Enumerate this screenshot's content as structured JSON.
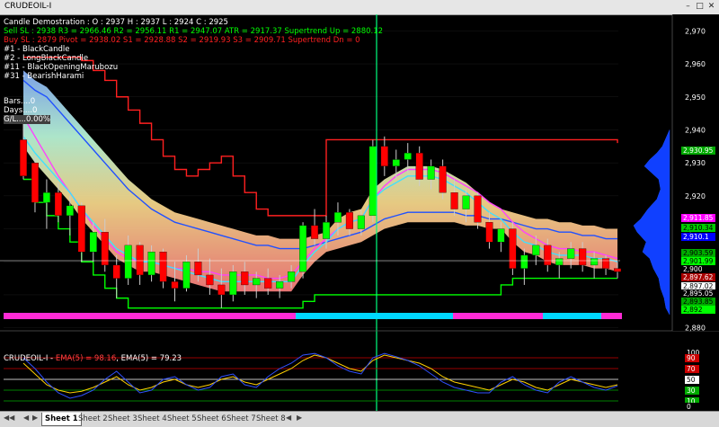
{
  "window": {
    "title": "CRUDEOIL-I",
    "controls": [
      "minimize",
      "maximize",
      "close"
    ]
  },
  "header": {
    "line1": "Candle Demostration : O : 2937 H : 2937 L : 2924 C : 2925",
    "line2": "Sell SL : 2938 R3 = 2966.46 R2 = 2956.11 R1 = 2947.07 ATR = 2917.37 Supertrend Up = 2880.12",
    "line3": "Buy SL : 2879 Pivot = 2938.02 S1 = 2928.88 S2 = 2919.93 S3 = 2909.71 Supertrend Dn = 0",
    "patterns": [
      "#1 - BlackCandle",
      "#2 - LongBlackCandle",
      "#11 - BlackOpeningMarubozu",
      "#31 - BearishHarami"
    ],
    "stats": [
      {
        "label": "Bars",
        "value": "0"
      },
      {
        "label": "Days",
        "value": "0"
      },
      {
        "label": "G/L",
        "value": "0.00%"
      }
    ]
  },
  "colors": {
    "up": "#00ff00",
    "down": "#ff0000",
    "bg": "#000000",
    "axis": "#ffffff",
    "sellText": "#00ff00",
    "buyText": "#ff0000"
  },
  "price_axis": {
    "ticks": [
      "2,970",
      "2,960",
      "2,950",
      "2,940",
      "2,930",
      "2,920",
      "2,910",
      "2,900",
      "2,890",
      "2,880"
    ],
    "labels": [
      {
        "value": "2,930.95",
        "bg": "#00aa00",
        "fg": "#ffffff"
      },
      {
        "value": "2,911.85",
        "bg": "#ff00ff",
        "fg": "#ffffff"
      },
      {
        "value": "2,910.34",
        "bg": "#00cc00",
        "fg": "#000000"
      },
      {
        "value": "2,910.1",
        "bg": "#0000ff",
        "fg": "#ffffff"
      },
      {
        "value": "2,903.59",
        "bg": "#00aa00",
        "fg": "#000000"
      },
      {
        "value": "2,901.99",
        "bg": "#00ff00",
        "fg": "#000000"
      },
      {
        "value": "2,900",
        "bg": "#000000",
        "fg": "#ffffff"
      },
      {
        "value": "2,897.62",
        "bg": "#aa0000",
        "fg": "#ffffff"
      },
      {
        "value": "2,897.02",
        "bg": "#ffffff",
        "fg": "#000000"
      },
      {
        "value": "2,895.05",
        "bg": "#000000",
        "fg": "#ffffff"
      },
      {
        "value": "2,893.85",
        "bg": "#00aa00",
        "fg": "#000000"
      },
      {
        "value": "2,892",
        "bg": "#00ff00",
        "fg": "#000000"
      }
    ]
  },
  "indicator": {
    "name": "CRUDEOIL-I",
    "ema1": "EMA(5) = 98.16",
    "ema2": "EMA(5) = 79.23",
    "levels": [
      {
        "value": "100",
        "bg": "#000000",
        "fg": "#ffffff"
      },
      {
        "value": "90",
        "bg": "#cc0000",
        "fg": "#ffffff"
      },
      {
        "value": "70",
        "bg": "#cc0000",
        "fg": "#ffffff"
      },
      {
        "value": "50",
        "bg": "#ffffff",
        "fg": "#000000"
      },
      {
        "value": "30",
        "bg": "#00aa00",
        "fg": "#ffffff"
      },
      {
        "value": "10",
        "bg": "#00aa00",
        "fg": "#ffffff"
      },
      {
        "value": "0",
        "bg": "#000000",
        "fg": "#ffffff"
      }
    ]
  },
  "sheets": {
    "active": "Sheet 1",
    "items": [
      "Sheet 1",
      "Sheet 2",
      "Sheet 3",
      "Sheet 4",
      "Sheet 5",
      "Sheet 6",
      "Sheet 7",
      "Sheet 8"
    ]
  },
  "chart_data": {
    "type": "candlestick",
    "ylim": [
      2878,
      2975
    ],
    "candles": [
      [
        2937,
        2944,
        2925,
        2926
      ],
      [
        2930,
        2932,
        2915,
        2918
      ],
      [
        2918,
        2925,
        2910,
        2921
      ],
      [
        2921,
        2924,
        2912,
        2914
      ],
      [
        2914,
        2920,
        2908,
        2917
      ],
      [
        2917,
        2918,
        2900,
        2903
      ],
      [
        2903,
        2912,
        2900,
        2909
      ],
      [
        2909,
        2913,
        2897,
        2899
      ],
      [
        2899,
        2902,
        2889,
        2895
      ],
      [
        2895,
        2908,
        2893,
        2905
      ],
      [
        2905,
        2906,
        2893,
        2896
      ],
      [
        2896,
        2905,
        2894,
        2903
      ],
      [
        2903,
        2904,
        2892,
        2894
      ],
      [
        2894,
        2900,
        2888,
        2892
      ],
      [
        2892,
        2902,
        2891,
        2900
      ],
      [
        2900,
        2904,
        2894,
        2896
      ],
      [
        2896,
        2901,
        2890,
        2893
      ],
      [
        2893,
        2898,
        2886,
        2890
      ],
      [
        2890,
        2899,
        2888,
        2897
      ],
      [
        2897,
        2900,
        2890,
        2893
      ],
      [
        2893,
        2897,
        2889,
        2895
      ],
      [
        2895,
        2898,
        2890,
        2892
      ],
      [
        2892,
        2896,
        2889,
        2894
      ],
      [
        2894,
        2899,
        2892,
        2897
      ],
      [
        2897,
        2912,
        2895,
        2911
      ],
      [
        2911,
        2916,
        2905,
        2907
      ],
      [
        2907,
        2914,
        2904,
        2912
      ],
      [
        2912,
        2918,
        2908,
        2915
      ],
      [
        2915,
        2916,
        2908,
        2910
      ],
      [
        2910,
        2916,
        2908,
        2914
      ],
      [
        2914,
        2937,
        2912,
        2935
      ],
      [
        2935,
        2938,
        2926,
        2929
      ],
      [
        2929,
        2934,
        2925,
        2931
      ],
      [
        2931,
        2936,
        2927,
        2933
      ],
      [
        2933,
        2935,
        2923,
        2925
      ],
      [
        2925,
        2931,
        2922,
        2929
      ],
      [
        2929,
        2931,
        2919,
        2921
      ],
      [
        2921,
        2925,
        2914,
        2916
      ],
      [
        2916,
        2922,
        2912,
        2920
      ],
      [
        2920,
        2921,
        2910,
        2912
      ],
      [
        2912,
        2915,
        2904,
        2906
      ],
      [
        2906,
        2912,
        2903,
        2910
      ],
      [
        2910,
        2912,
        2896,
        2898
      ],
      [
        2898,
        2904,
        2893,
        2902
      ],
      [
        2902,
        2908,
        2899,
        2905
      ],
      [
        2905,
        2907,
        2897,
        2899
      ],
      [
        2899,
        2903,
        2895,
        2901
      ],
      [
        2901,
        2906,
        2898,
        2904
      ],
      [
        2904,
        2906,
        2897,
        2899
      ],
      [
        2899,
        2903,
        2895,
        2901
      ],
      [
        2901,
        2902,
        2896,
        2898
      ],
      [
        2898,
        2900,
        2895,
        2897
      ]
    ],
    "overlays": [
      {
        "name": "resistance",
        "color": "#ff2020",
        "values": [
          2962,
          2962,
          2962,
          2962,
          2962,
          2961,
          2958,
          2955,
          2950,
          2946,
          2942,
          2937,
          2932,
          2928,
          2926,
          2928,
          2930,
          2932,
          2926,
          2921,
          2916,
          2914,
          2914,
          2914,
          2914,
          2914,
          2937,
          2937,
          2937,
          2937,
          2937,
          2937,
          2937,
          2937,
          2937,
          2937,
          2937,
          2937,
          2937,
          2937,
          2937,
          2937,
          2937,
          2937,
          2937,
          2937,
          2937,
          2937,
          2937,
          2937,
          2937,
          2936
        ]
      },
      {
        "name": "support",
        "color": "#00ff00",
        "values": [
          2925,
          2918,
          2914,
          2910,
          2906,
          2900,
          2896,
          2892,
          2889,
          2886,
          2886,
          2886,
          2886,
          2886,
          2886,
          2886,
          2886,
          2886,
          2886,
          2886,
          2886,
          2886,
          2886,
          2886,
          2888,
          2890,
          2890,
          2890,
          2890,
          2890,
          2890,
          2890,
          2890,
          2890,
          2890,
          2890,
          2890,
          2890,
          2890,
          2890,
          2890,
          2893,
          2895,
          2895,
          2895,
          2895,
          2895,
          2895,
          2895,
          2895,
          2895,
          2895
        ]
      },
      {
        "name": "ema-blue",
        "color": "#2050ff",
        "values": [
          2955,
          2952,
          2950,
          2946,
          2942,
          2938,
          2934,
          2930,
          2926,
          2922,
          2919,
          2916,
          2914,
          2912,
          2911,
          2910,
          2909,
          2908,
          2907,
          2906,
          2905,
          2905,
          2904,
          2904,
          2904,
          2905,
          2906,
          2907,
          2908,
          2909,
          2911,
          2913,
          2914,
          2915,
          2915,
          2915,
          2915,
          2915,
          2914,
          2914,
          2913,
          2913,
          2912,
          2911,
          2910,
          2910,
          2909,
          2909,
          2908,
          2908,
          2907,
          2907
        ]
      },
      {
        "name": "ema-magenta",
        "color": "#ff40ff",
        "values": [
          2944,
          2938,
          2932,
          2926,
          2921,
          2916,
          2911,
          2907,
          2903,
          2901,
          2900,
          2900,
          2899,
          2898,
          2898,
          2897,
          2897,
          2896,
          2896,
          2896,
          2896,
          2895,
          2895,
          2896,
          2900,
          2904,
          2907,
          2910,
          2912,
          2913,
          2919,
          2923,
          2926,
          2928,
          2928,
          2928,
          2927,
          2925,
          2923,
          2921,
          2918,
          2916,
          2912,
          2909,
          2907,
          2905,
          2904,
          2904,
          2903,
          2903,
          2902,
          2901
        ]
      },
      {
        "name": "ema-cyan",
        "color": "#40e0ff",
        "values": [
          2938,
          2933,
          2929,
          2925,
          2921,
          2916,
          2912,
          2908,
          2904,
          2902,
          2900,
          2900,
          2899,
          2898,
          2897,
          2896,
          2895,
          2894,
          2894,
          2894,
          2894,
          2894,
          2894,
          2894,
          2899,
          2903,
          2906,
          2910,
          2912,
          2913,
          2919,
          2922,
          2924,
          2926,
          2926,
          2926,
          2925,
          2923,
          2921,
          2918,
          2915,
          2913,
          2909,
          2906,
          2905,
          2903,
          2902,
          2902,
          2902,
          2901,
          2901,
          2900
        ]
      }
    ],
    "oscillator": {
      "type": "line",
      "ylim": [
        0,
        100
      ],
      "levels": [
        90,
        70,
        50,
        30,
        10
      ],
      "series": [
        {
          "name": "EMA(5)",
          "color": "#ffd000",
          "values": [
            80,
            60,
            40,
            30,
            25,
            28,
            35,
            45,
            55,
            40,
            30,
            35,
            45,
            50,
            40,
            35,
            40,
            50,
            55,
            45,
            40,
            50,
            60,
            70,
            85,
            95,
            90,
            80,
            70,
            65,
            85,
            95,
            90,
            85,
            80,
            70,
            55,
            45,
            40,
            35,
            30,
            40,
            50,
            45,
            35,
            30,
            40,
            50,
            45,
            40,
            35,
            40
          ]
        },
        {
          "name": "EMA(5)",
          "color": "#3050ff",
          "values": [
            90,
            70,
            45,
            25,
            15,
            20,
            30,
            50,
            65,
            45,
            25,
            30,
            50,
            55,
            40,
            30,
            35,
            55,
            60,
            40,
            35,
            55,
            70,
            80,
            95,
            98,
            90,
            75,
            65,
            60,
            90,
            98,
            92,
            85,
            75,
            60,
            45,
            35,
            30,
            25,
            25,
            45,
            55,
            40,
            30,
            25,
            45,
            55,
            45,
            35,
            30,
            38
          ]
        }
      ]
    }
  }
}
